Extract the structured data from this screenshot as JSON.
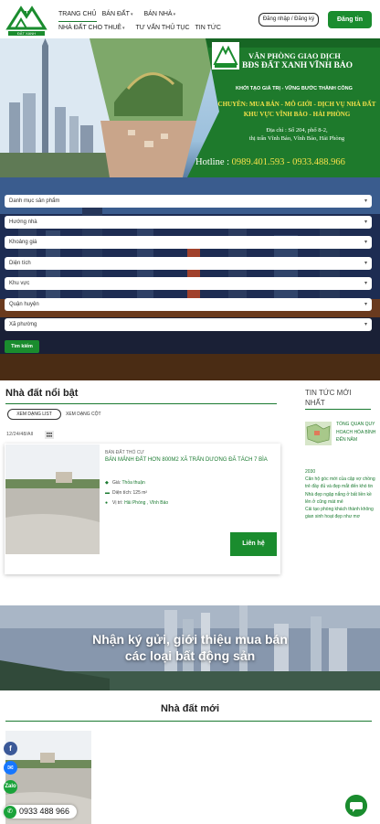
{
  "header": {
    "nav": [
      {
        "label": "TRANG CHỦ",
        "active": true,
        "caret": false
      },
      {
        "label": "BÁN ĐẤT",
        "active": false,
        "caret": true
      },
      {
        "label": "BÁN NHÀ",
        "active": false,
        "caret": true
      },
      {
        "label": "NHÀ ĐẤT CHO THUÊ",
        "active": false,
        "caret": true
      },
      {
        "label": "TƯ VẤN THỦ TỤC",
        "active": false,
        "caret": false
      },
      {
        "label": "TIN TỨC",
        "active": false,
        "caret": false
      }
    ],
    "login_label": "Đăng nhập / Đăng ký",
    "register_label": "Đăng tin",
    "logo_text": "ĐẤT XANH"
  },
  "banner": {
    "title1": "VĂN PHÒNG GIAO DỊCH",
    "title2": "BĐS ĐẤT XANH VĨNH BẢO",
    "slogan": "KHỞI TẠO GIÁ TRỊ - VỮNG BƯỚC THÀNH CÔNG",
    "spec1": "CHUYÊN: MUA BÁN - MÔ GIỚI - DỊCH VỤ NHÀ ĐẤT",
    "spec2": "KHU VỰC VĨNH BẢO - HẢI PHÒNG",
    "addr1": "Địa chỉ : Số 204, phố 8-2,",
    "addr2": "thị trấn Vĩnh Bảo, Vĩnh Bảo, Hải Phòng",
    "hotline_label": "Hotline :",
    "hotline": "0989.401.593 - 0933.488.966"
  },
  "filters": [
    "Danh mục sản phẩm",
    "Hướng nhà",
    "Khoảng giá",
    "Diện tích",
    "Khu vực",
    "Quận huyện",
    "Xã phường"
  ],
  "search_label": "Tìm kiếm",
  "featured": {
    "title": "Nhà đất nổi bật",
    "tab_list": "XEM DẠNG LIST",
    "tab_column": "XEM DẠNG CỘT",
    "count": "12/24/48/All",
    "card": {
      "category": "BÁN ĐẤT THỔ CƯ",
      "title": "BÁN MẢNH ĐẤT HƠN 800M2 XÃ TRẤN DƯƠNG ĐÃ TÁCH 7 BÌA",
      "price_label": "Giá:",
      "price": "Thỏa thuận",
      "area_label": "Diện tích:",
      "area": "125 m²",
      "location_label": "Vị trí:",
      "location": "Hải Phòng , Vĩnh Bảo",
      "contact_label": "Liên hệ"
    }
  },
  "news": {
    "title": "TIN TỨC MỚI NHẤT",
    "head": "TỔNG QUAN QUY HOẠCH HÓA BÌNH ĐẾN NĂM",
    "items": [
      "2030",
      "Căn hộ góc mới của cặp vợ chồng trẻ đầy đủ và đẹp mắt đến khó tin",
      "Nhà đẹp ngập nắng ở bất liền kề lên ở cũng mát mẻ",
      "Cải tạo phòng khách thành không gian sinh hoạt đẹp như mơ"
    ]
  },
  "consign": {
    "line1": "Nhận ký gửi, giới thiệu mua bán",
    "line2": "các loại bất động sản"
  },
  "new_listings": {
    "title": "Nhà đất mới"
  },
  "float": {
    "phone": "0933 488 966"
  },
  "colors": {
    "brand": "#1a8c2e",
    "accent_yellow": "#f5e04a"
  }
}
